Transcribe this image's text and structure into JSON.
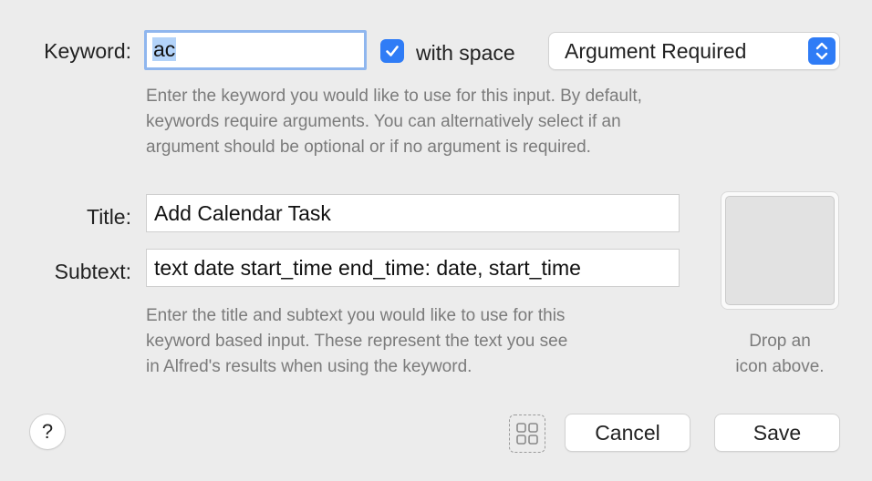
{
  "keyword": {
    "label": "Keyword:",
    "value": "ac",
    "with_space_label": "with space",
    "with_space_checked": true,
    "argument_select": "Argument Required",
    "help": [
      "Enter the keyword you would like to use for this input. By default,",
      "keywords require arguments. You can alternatively select if an",
      "argument should be optional or if no argument is required."
    ]
  },
  "title": {
    "label": "Title:",
    "value": "Add Calendar Task"
  },
  "subtext": {
    "label": "Subtext:",
    "value": "text date start_time end_time: date, start_time"
  },
  "title_help": [
    "Enter the title and subtext you would like to use for this",
    "keyword based input. These represent the text you see",
    "in Alfred's results when using the keyword."
  ],
  "icon_drop": {
    "hint_line1": "Drop an",
    "hint_line2": "icon above."
  },
  "footer": {
    "help_label": "?",
    "cancel_label": "Cancel",
    "save_label": "Save"
  },
  "colors": {
    "accent": "#2f7cf6",
    "focus_ring": "#8fb6ee",
    "selection": "#b3d3f9",
    "background": "#ececec"
  },
  "icons": {
    "checkbox": "checkmark-icon",
    "stepper": "up-down-chevron-icon",
    "grid": "grid-icon"
  }
}
